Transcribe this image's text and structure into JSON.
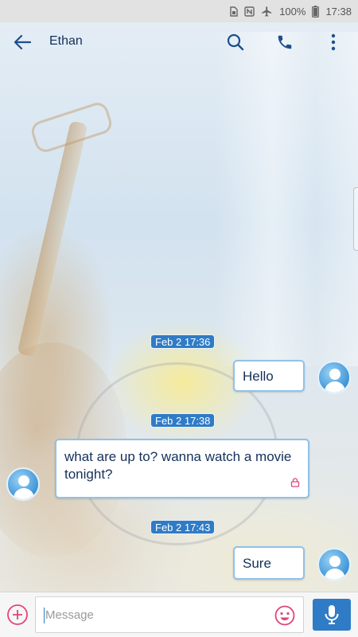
{
  "status_bar": {
    "battery_percent": "100%",
    "time": "17:38"
  },
  "header": {
    "contact_name": "Ethan"
  },
  "messages": [
    {
      "date": "Feb 2 17:36",
      "direction": "outgoing",
      "text": "Hello"
    },
    {
      "date": "Feb 2 17:38",
      "direction": "incoming",
      "text": "what are up to? wanna watch a movie tonight?",
      "locked": true
    },
    {
      "date": "Feb 2 17:43",
      "direction": "outgoing",
      "text": "Sure"
    }
  ],
  "compose": {
    "placeholder": "Message"
  },
  "colors": {
    "accent": "#2f7bc6",
    "text": "#14305a",
    "bubble_border": "#8fc2ea",
    "lock": "#e0457a"
  },
  "icons": [
    "nfc-icon",
    "airplane-icon",
    "battery-icon",
    "back-arrow-icon",
    "search-icon",
    "phone-icon",
    "more-vert-icon",
    "lock-icon",
    "add-circle-icon",
    "emoji-icon",
    "mic-icon",
    "avatar-icon"
  ]
}
